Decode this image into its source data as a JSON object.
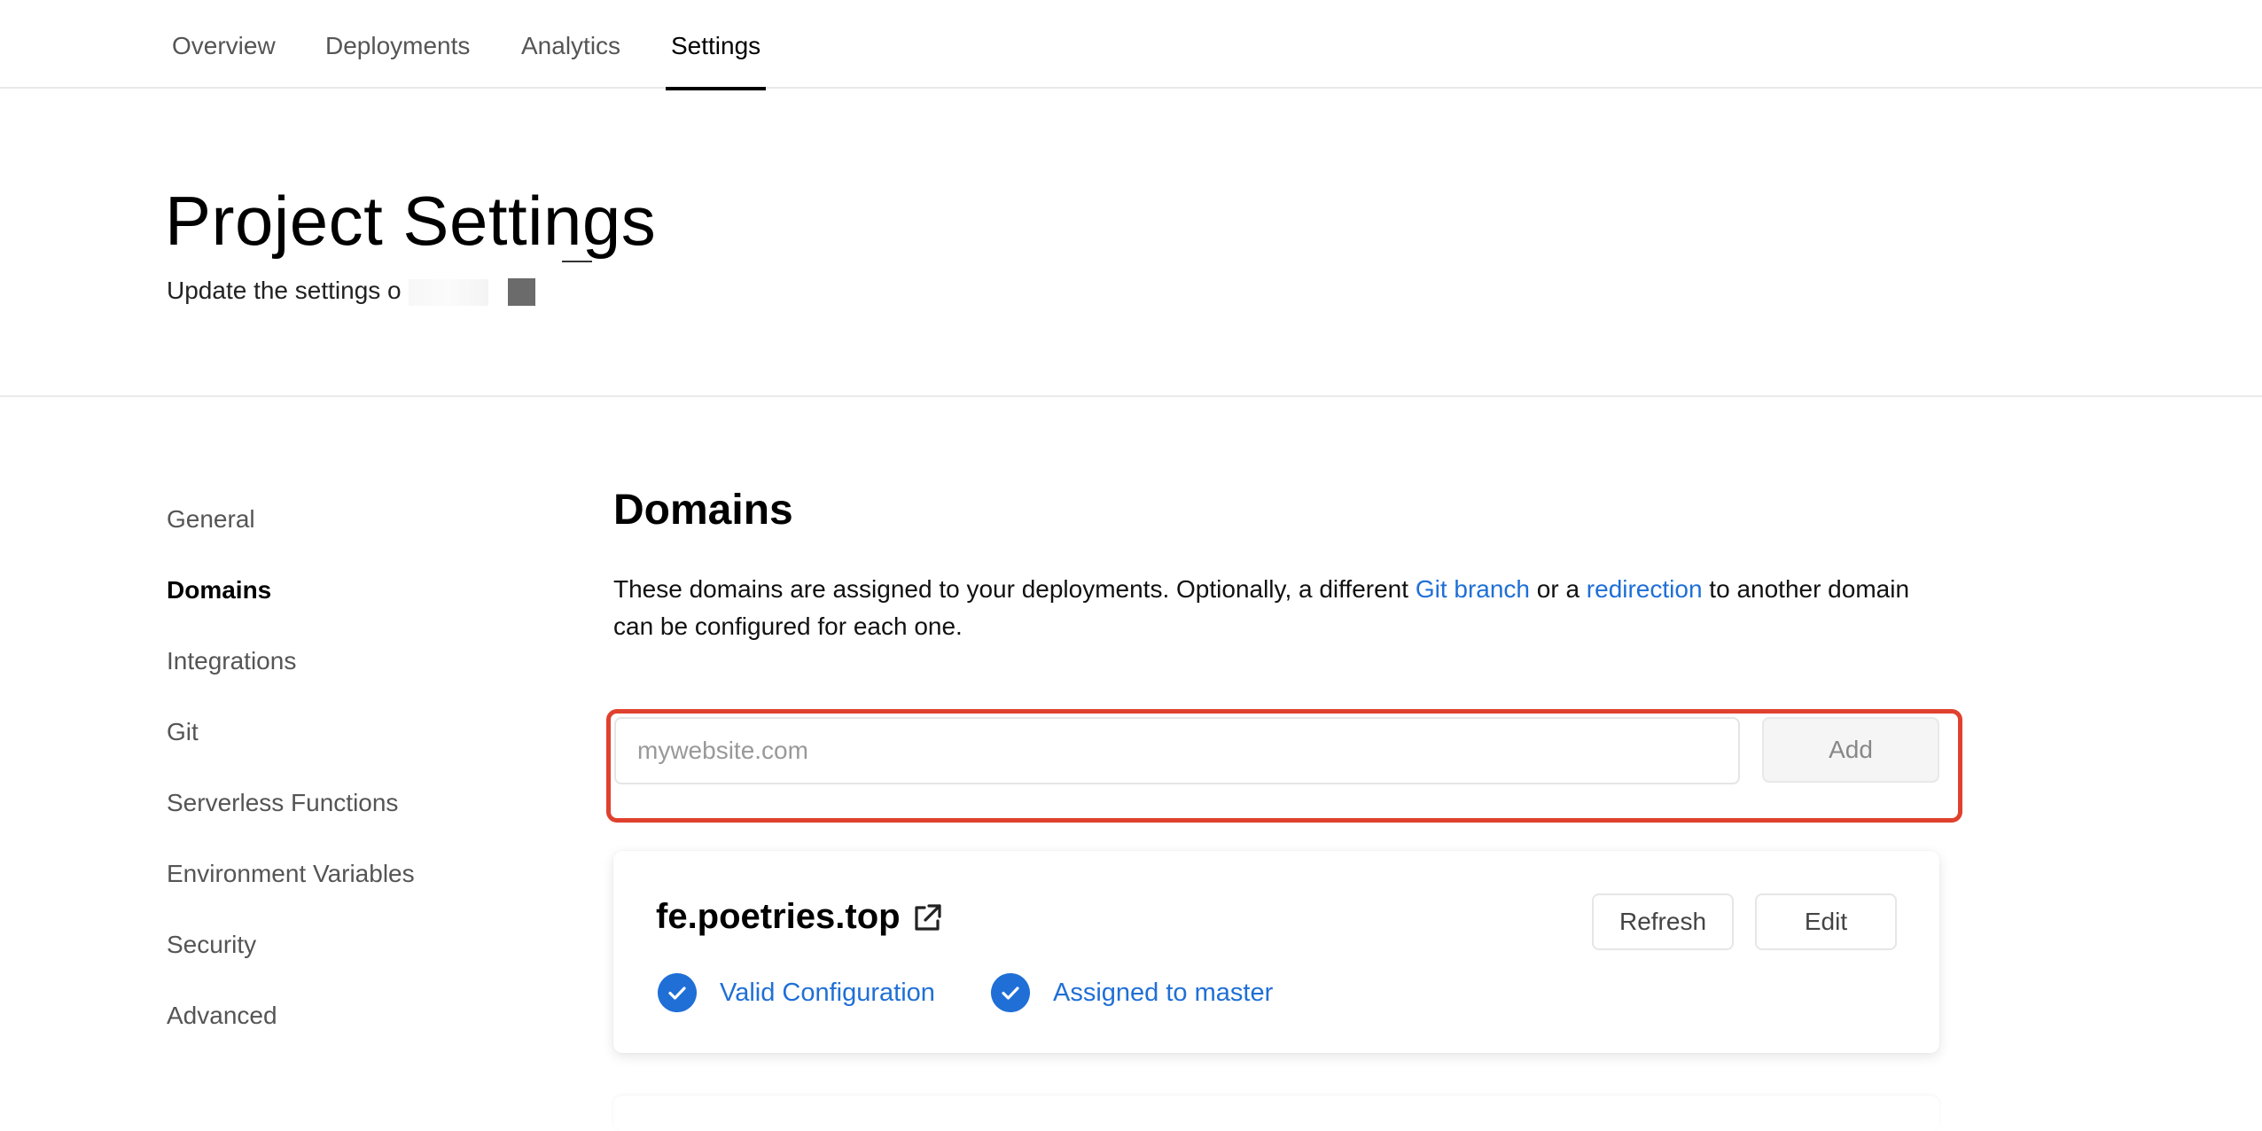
{
  "nav": {
    "tabs": [
      {
        "label": "Overview"
      },
      {
        "label": "Deployments"
      },
      {
        "label": "Analytics"
      },
      {
        "label": "Settings",
        "active": true
      }
    ]
  },
  "header": {
    "title": "Project Settings",
    "subtitle": "Update the settings o"
  },
  "sidebar": {
    "items": [
      {
        "label": "General"
      },
      {
        "label": "Domains",
        "active": true
      },
      {
        "label": "Integrations"
      },
      {
        "label": "Git"
      },
      {
        "label": "Serverless Functions"
      },
      {
        "label": "Environment Variables"
      },
      {
        "label": "Security"
      },
      {
        "label": "Advanced"
      }
    ]
  },
  "domains": {
    "title": "Domains",
    "description_part1": "These domains are assigned to your deployments. Optionally, a different ",
    "link_git_branch": "Git branch",
    "description_part2": " or a ",
    "link_redirection": "redirection",
    "description_part3": " to another domain can be configured for each one.",
    "input_placeholder": "mywebsite.com",
    "input_value": "",
    "add_label": "Add",
    "highlight_color": "#e0412e"
  },
  "domain_card": {
    "name": "fe.poetries.top",
    "refresh_label": "Refresh",
    "edit_label": "Edit",
    "status_valid": "Valid Configuration",
    "status_assigned": "Assigned to master",
    "accent_color": "#1f6fd6"
  },
  "icons": {
    "external_link": "external-link-icon",
    "check": "check-circle-icon"
  }
}
